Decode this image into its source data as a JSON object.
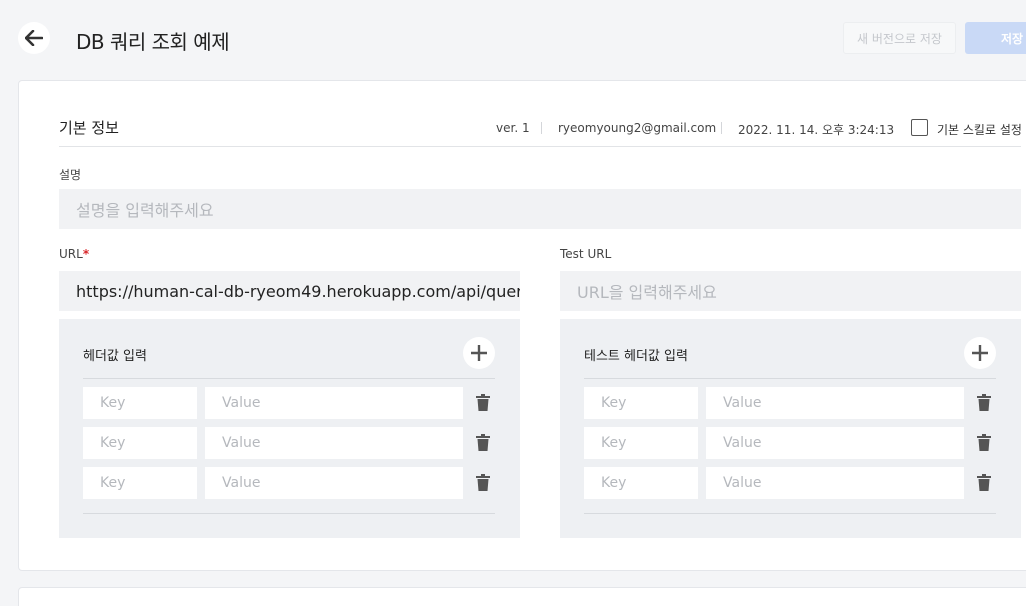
{
  "header": {
    "title": "DB 쿼리 조회 예제",
    "save_as_label": "새 버전으로 저장",
    "save_label": "저장"
  },
  "basic": {
    "section_title": "기본 정보",
    "version": "ver. 1",
    "email": "ryeomyoung2@gmail.com",
    "timestamp": "2022. 11. 14. 오후 3:24:13",
    "default_skill_label": "기본 스킬로 설정",
    "default_skill_checked": false
  },
  "description": {
    "label": "설명",
    "placeholder": "설명을 입력해주세요",
    "value": ""
  },
  "url": {
    "label": "URL",
    "required_mark": "*",
    "value": "https://human-cal-db-ryeom49.herokuapp.com/api/quer"
  },
  "test_url": {
    "label": "Test URL",
    "placeholder": "URL을 입력해주세요",
    "value": ""
  },
  "headers": {
    "title": "헤더값 입력",
    "rows": [
      {
        "key_placeholder": "Key",
        "value_placeholder": "Value"
      },
      {
        "key_placeholder": "Key",
        "value_placeholder": "Value"
      },
      {
        "key_placeholder": "Key",
        "value_placeholder": "Value"
      }
    ]
  },
  "test_headers": {
    "title": "테스트 헤더값 입력",
    "rows": [
      {
        "key_placeholder": "Key",
        "value_placeholder": "Value"
      },
      {
        "key_placeholder": "Key",
        "value_placeholder": "Value"
      },
      {
        "key_placeholder": "Key",
        "value_placeholder": "Value"
      }
    ]
  },
  "icons": {
    "back": "arrow-left-icon",
    "add": "plus-icon",
    "delete": "trash-icon"
  },
  "colors": {
    "primary_disabled": "#c9d9f6",
    "required": "#d9262a",
    "panel_bg": "#eef0f3"
  }
}
